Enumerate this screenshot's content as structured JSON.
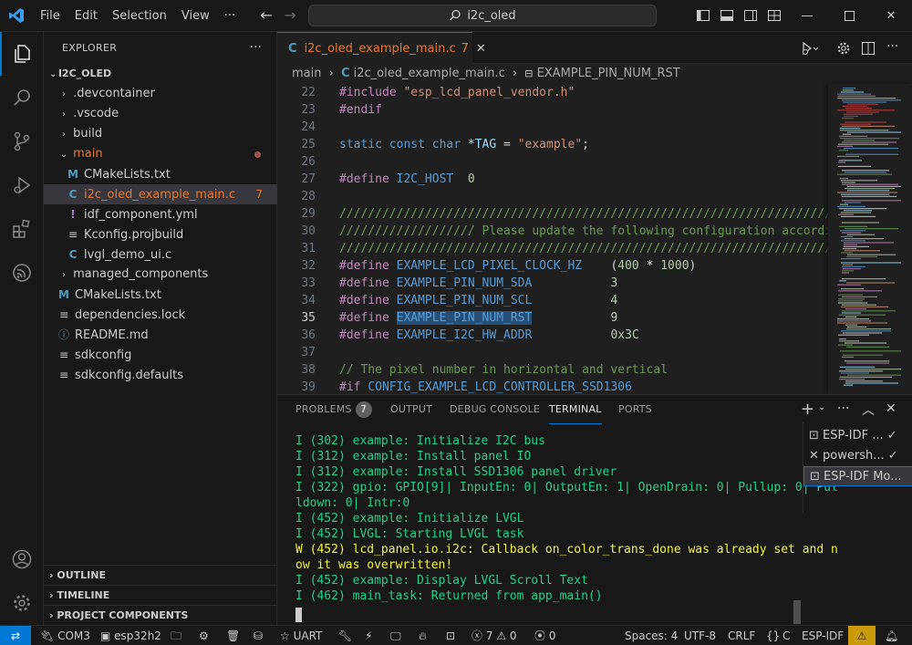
{
  "menu": {
    "file": "File",
    "edit": "Edit",
    "selection": "Selection",
    "view": "View",
    "more": "···",
    "search": "i2c_oled"
  },
  "explorer": {
    "title": "EXPLORER",
    "root": "I2C_OLED",
    "items": [
      {
        "label": ".devcontainer",
        "type": "folder",
        "open": false
      },
      {
        "label": ".vscode",
        "type": "folder",
        "open": false
      },
      {
        "label": "build",
        "type": "folder",
        "open": false
      },
      {
        "label": "main",
        "type": "folder",
        "open": true
      },
      {
        "label": "CMakeLists.txt",
        "type": "cmake"
      },
      {
        "label": "i2c_oled_example_main.c",
        "type": "c",
        "badge": "7"
      },
      {
        "label": "idf_component.yml",
        "type": "yml"
      },
      {
        "label": "Kconfig.projbuild",
        "type": "list"
      },
      {
        "label": "lvgl_demo_ui.c",
        "type": "c"
      },
      {
        "label": "managed_components",
        "type": "folder",
        "open": false
      },
      {
        "label": "CMakeLists.txt",
        "type": "cmake"
      },
      {
        "label": "dependencies.lock",
        "type": "list"
      },
      {
        "label": "README.md",
        "type": "md"
      },
      {
        "label": "sdkconfig",
        "type": "list"
      },
      {
        "label": "sdkconfig.defaults",
        "type": "list"
      }
    ],
    "sections": [
      "OUTLINE",
      "TIMELINE",
      "PROJECT COMPONENTS"
    ]
  },
  "editor": {
    "tab_label": "i2c_oled_example_main.c",
    "tab_problems": "7",
    "breadcrumb": {
      "folder": "main",
      "file": "i2c_oled_example_main.c",
      "symbol": "EXAMPLE_PIN_NUM_RST"
    },
    "lines": [
      {
        "n": "22",
        "code": "#include \"esp_lcd_panel_vendor.h\""
      },
      {
        "n": "23",
        "code": "#endif"
      },
      {
        "n": "24",
        "code": ""
      },
      {
        "n": "25",
        "code": "static const char *TAG = \"example\";"
      },
      {
        "n": "26",
        "code": ""
      },
      {
        "n": "27",
        "code": "#define I2C_HOST  0"
      },
      {
        "n": "28",
        "code": ""
      },
      {
        "n": "29",
        "code": "////////////////////////////////////////////////////////////////////////////////"
      },
      {
        "n": "30",
        "code": "/////////////////// Please update the following configuration according to your"
      },
      {
        "n": "31",
        "code": "////////////////////////////////////////////////////////////////////////////////"
      },
      {
        "n": "32",
        "code": "#define EXAMPLE_LCD_PIXEL_CLOCK_HZ    (400 * 1000)"
      },
      {
        "n": "33",
        "code": "#define EXAMPLE_PIN_NUM_SDA           3"
      },
      {
        "n": "34",
        "code": "#define EXAMPLE_PIN_NUM_SCL           4"
      },
      {
        "n": "35",
        "code": "#define EXAMPLE_PIN_NUM_RST           9"
      },
      {
        "n": "36",
        "code": "#define EXAMPLE_I2C_HW_ADDR           0x3C"
      },
      {
        "n": "37",
        "code": ""
      },
      {
        "n": "38",
        "code": "// The pixel number in horizontal and vertical"
      },
      {
        "n": "39",
        "code": "#if CONFIG_EXAMPLE_LCD_CONTROLLER_SSD1306"
      }
    ]
  },
  "panel": {
    "tabs": {
      "problems": "PROBLEMS",
      "problems_count": "7",
      "output": "OUTPUT",
      "debug": "DEBUG CONSOLE",
      "terminal": "TERMINAL",
      "ports": "PORTS"
    },
    "terminal_lines": [
      {
        "text": "I (302) example: Initialize I2C bus",
        "level": "info"
      },
      {
        "text": "I (312) example: Install panel IO",
        "level": "info"
      },
      {
        "text": "I (312) example: Install SSD1306 panel driver",
        "level": "info"
      },
      {
        "text": "I (322) gpio: GPIO[9]| InputEn: 0| OutputEn: 1| OpenDrain: 0| Pullup: 0| Pul",
        "level": "info"
      },
      {
        "text": "ldown: 0| Intr:0",
        "level": "info"
      },
      {
        "text": "I (452) example: Initialize LVGL",
        "level": "info"
      },
      {
        "text": "I (452) LVGL: Starting LVGL task",
        "level": "info"
      },
      {
        "text": "W (452) lcd_panel.io.i2c: Callback on_color_trans_done was already set and n",
        "level": "warn"
      },
      {
        "text": "ow it was overwritten!",
        "level": "warn"
      },
      {
        "text": "I (452) example: Display LVGL Scroll Text",
        "level": "info"
      },
      {
        "text": "I (462) main_task: Returned from app_main()",
        "level": "info"
      }
    ],
    "terminals": [
      "ESP-IDF ...",
      "powersh...",
      "ESP-IDF Mo..."
    ]
  },
  "status": {
    "port": "COM3",
    "target": "esp32h2",
    "uart": "UART",
    "problems_errors": "7",
    "problems_warnings": "0",
    "ports": "0",
    "spaces": "Spaces: 4",
    "encoding": "UTF-8",
    "eol": "CRLF",
    "lang": "C",
    "idf": "ESP-IDF"
  },
  "colors": {
    "accent": "#0078d4",
    "modified": "#e37933",
    "term_info": "#23d18b",
    "term_warn": "#f5f543"
  }
}
